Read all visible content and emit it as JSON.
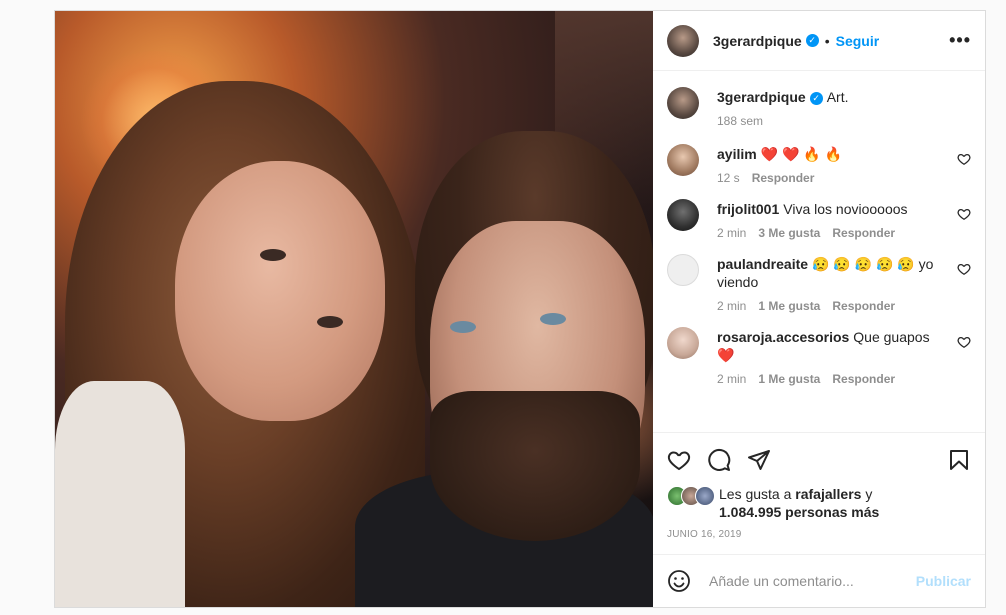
{
  "post": {
    "username": "3gerardpique",
    "follow_label": "Seguir",
    "more_label": "•••",
    "dot": "•",
    "verified_glyph": "✓",
    "caption": "Art.",
    "caption_age": "188 sem"
  },
  "comments": [
    {
      "user": "ayilim",
      "text": "❤️ ❤️ 🔥 🔥",
      "time": "12 s",
      "likes": "",
      "reply": "Responder"
    },
    {
      "user": "frijolit001",
      "text": "Viva los noviooooos",
      "time": "2 min",
      "likes": "3 Me gusta",
      "reply": "Responder"
    },
    {
      "user": "paulandreaite",
      "text": "😥 😥 😥 😥 😥 yo viendo",
      "time": "2 min",
      "likes": "1 Me gusta",
      "reply": "Responder"
    },
    {
      "user": "rosaroja.accesorios",
      "text": "Que guapos ❤️",
      "time": "2 min",
      "likes": "1 Me gusta",
      "reply": "Responder"
    }
  ],
  "likes": {
    "prefix": "Les gusta a",
    "user": "rafajallers",
    "middle": "y",
    "count": "1.084.995 personas más"
  },
  "date": "JUNIO 16, 2019",
  "add_comment": {
    "placeholder": "Añade un comentario...",
    "publish": "Publicar"
  },
  "colors": {
    "accent": "#0095f6",
    "heart": "#ed4956",
    "publish_disabled": "#b2dffc"
  }
}
